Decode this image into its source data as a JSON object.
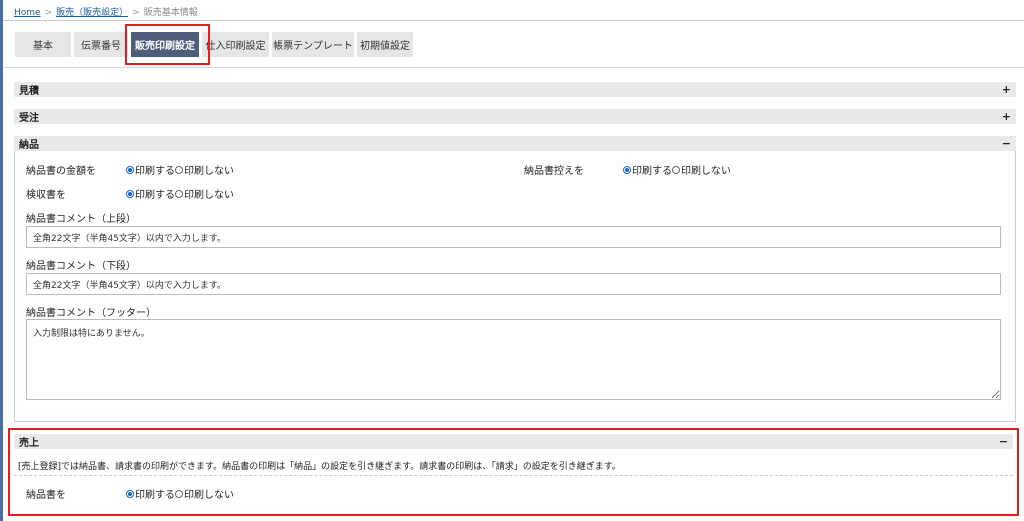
{
  "breadcrumb": {
    "home": "Home",
    "parent": "販売（販売設定）",
    "current": "販売基本情報",
    "separator": ">"
  },
  "tabs": [
    {
      "label": "基本",
      "active": false
    },
    {
      "label": "伝票番号",
      "active": false
    },
    {
      "label": "販売印刷設定",
      "active": true
    },
    {
      "label": "仕入印刷設定",
      "active": false
    },
    {
      "label": "帳票テンプレート",
      "active": false
    },
    {
      "label": "初期値設定",
      "active": false
    }
  ],
  "sections": {
    "mitsumori": {
      "title": "見積",
      "toggle": "+"
    },
    "juchu": {
      "title": "受注",
      "toggle": "+"
    },
    "nohin": {
      "title": "納品",
      "toggle": "−",
      "amount_label": "納品書の金額を",
      "copy_label": "納品書控えを",
      "kenshu_label": "検収書を",
      "comment_upper_label": "納品書コメント（上段）",
      "comment_upper_value": "全角22文字（半角45文字）以内で入力します。",
      "comment_lower_label": "納品書コメント（下段）",
      "comment_lower_value": "全角22文字（半角45文字）以内で入力します。",
      "comment_footer_label": "納品書コメント（フッター）",
      "comment_footer_value": "入力制限は特にありません。"
    },
    "uriage": {
      "title": "売上",
      "toggle": "−",
      "note": "[売上登録]では納品書、請求書の印刷ができます。納品書の印刷は「納品」の設定を引き継ぎます。請求書の印刷は、「請求」の設定を引き継ぎます。",
      "nohin_label": "納品書を"
    }
  },
  "radio": {
    "print": "印刷する",
    "no_print": "印刷しない"
  },
  "colors": {
    "accent": "#1a66cc",
    "active_tab": "#4d5d7a",
    "highlight": "#e02020"
  }
}
